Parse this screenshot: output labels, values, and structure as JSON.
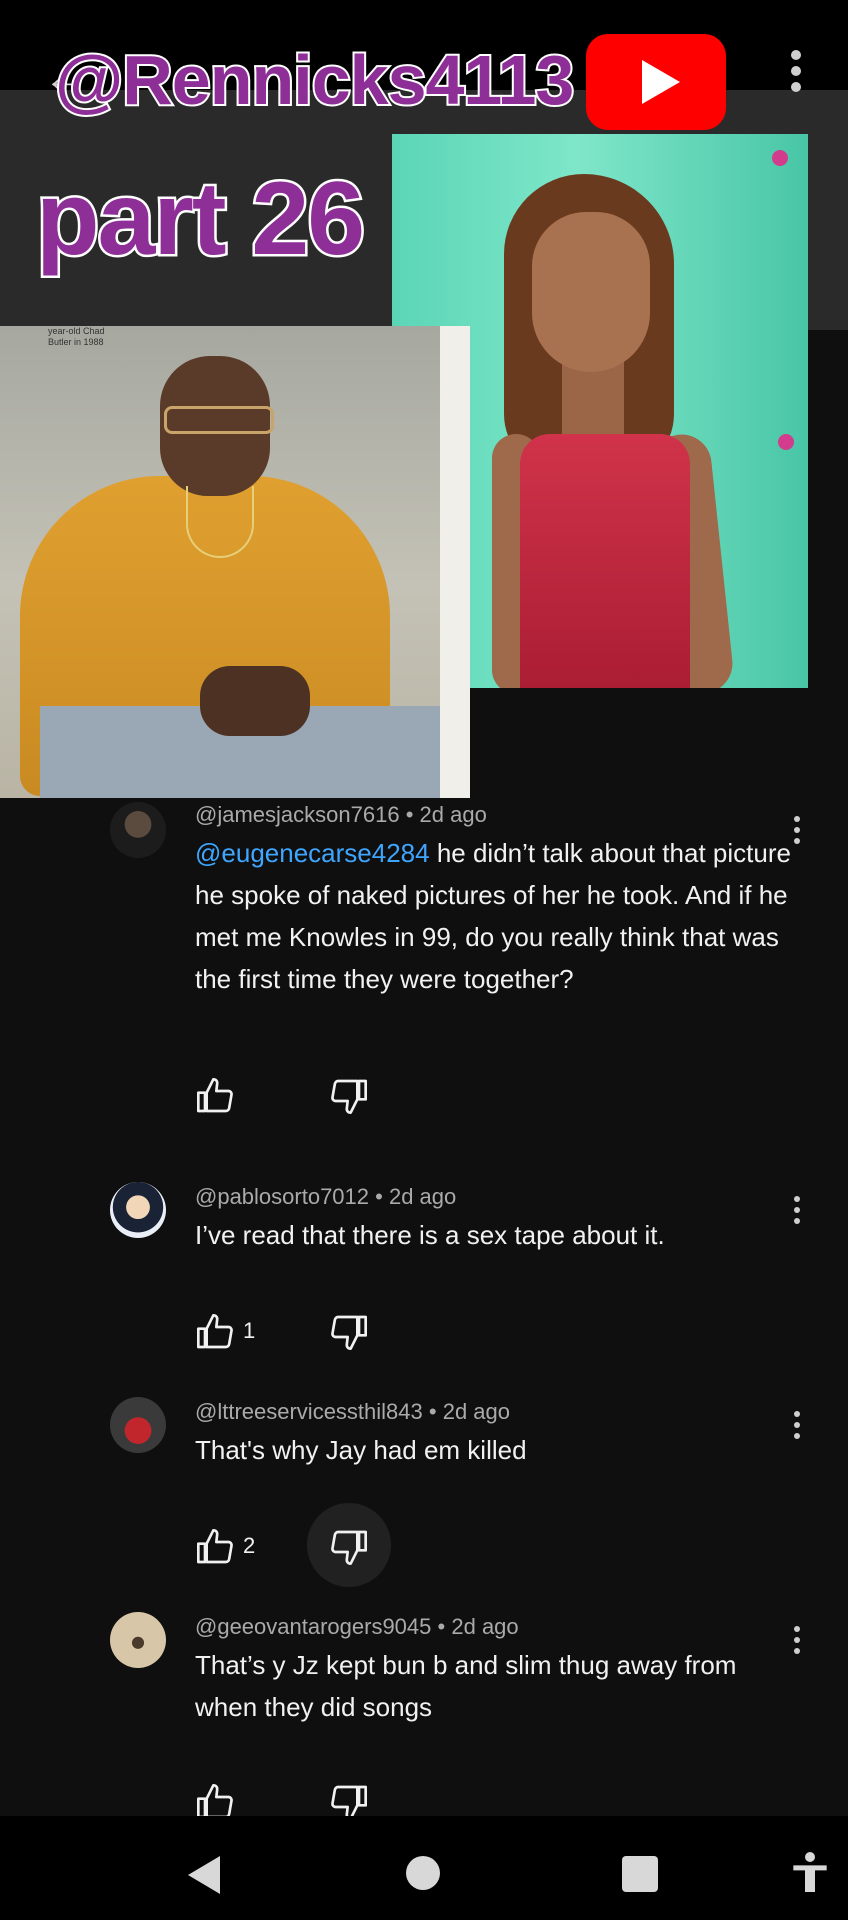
{
  "overlay": {
    "handle": "@Rennicks4113",
    "part_label": "part 26"
  },
  "left_photo": {
    "caption": "year-old Chad Butler in 1988"
  },
  "comments": [
    {
      "author": "@jamesjackson7616",
      "age": "2d ago",
      "mention": "@eugenecarse4284",
      "text": "he didn’t talk about that picture he spoke of naked pictures of her he took.  And if he met me Knowles in 99, do you really think that was the first time they were together?",
      "likes": ""
    },
    {
      "author": "@pablosorto7012",
      "age": "2d ago",
      "text": "I’ve read that there is a sex tape about it.",
      "likes": "1"
    },
    {
      "author": "@lttreeservicessthil843",
      "age": "2d ago",
      "text": "That's why Jay had em killed",
      "likes": "2"
    },
    {
      "author": "@geeovantarogers9045",
      "age": "2d ago",
      "text": "That’s y Jz kept bun b and slim thug away from when they did songs",
      "likes": ""
    }
  ],
  "meta_separator": "•",
  "colors": {
    "background": "#0f0f0f",
    "mention": "#3ea6ff",
    "overlay_text": "#8e2f97",
    "youtube_red": "#ff0000"
  },
  "icons": [
    "back-arrow-icon",
    "more-vert-icon",
    "youtube-logo-icon",
    "thumbs-up-icon",
    "thumbs-down-icon",
    "nav-back-icon",
    "nav-home-icon",
    "nav-recents-icon",
    "accessibility-icon"
  ]
}
